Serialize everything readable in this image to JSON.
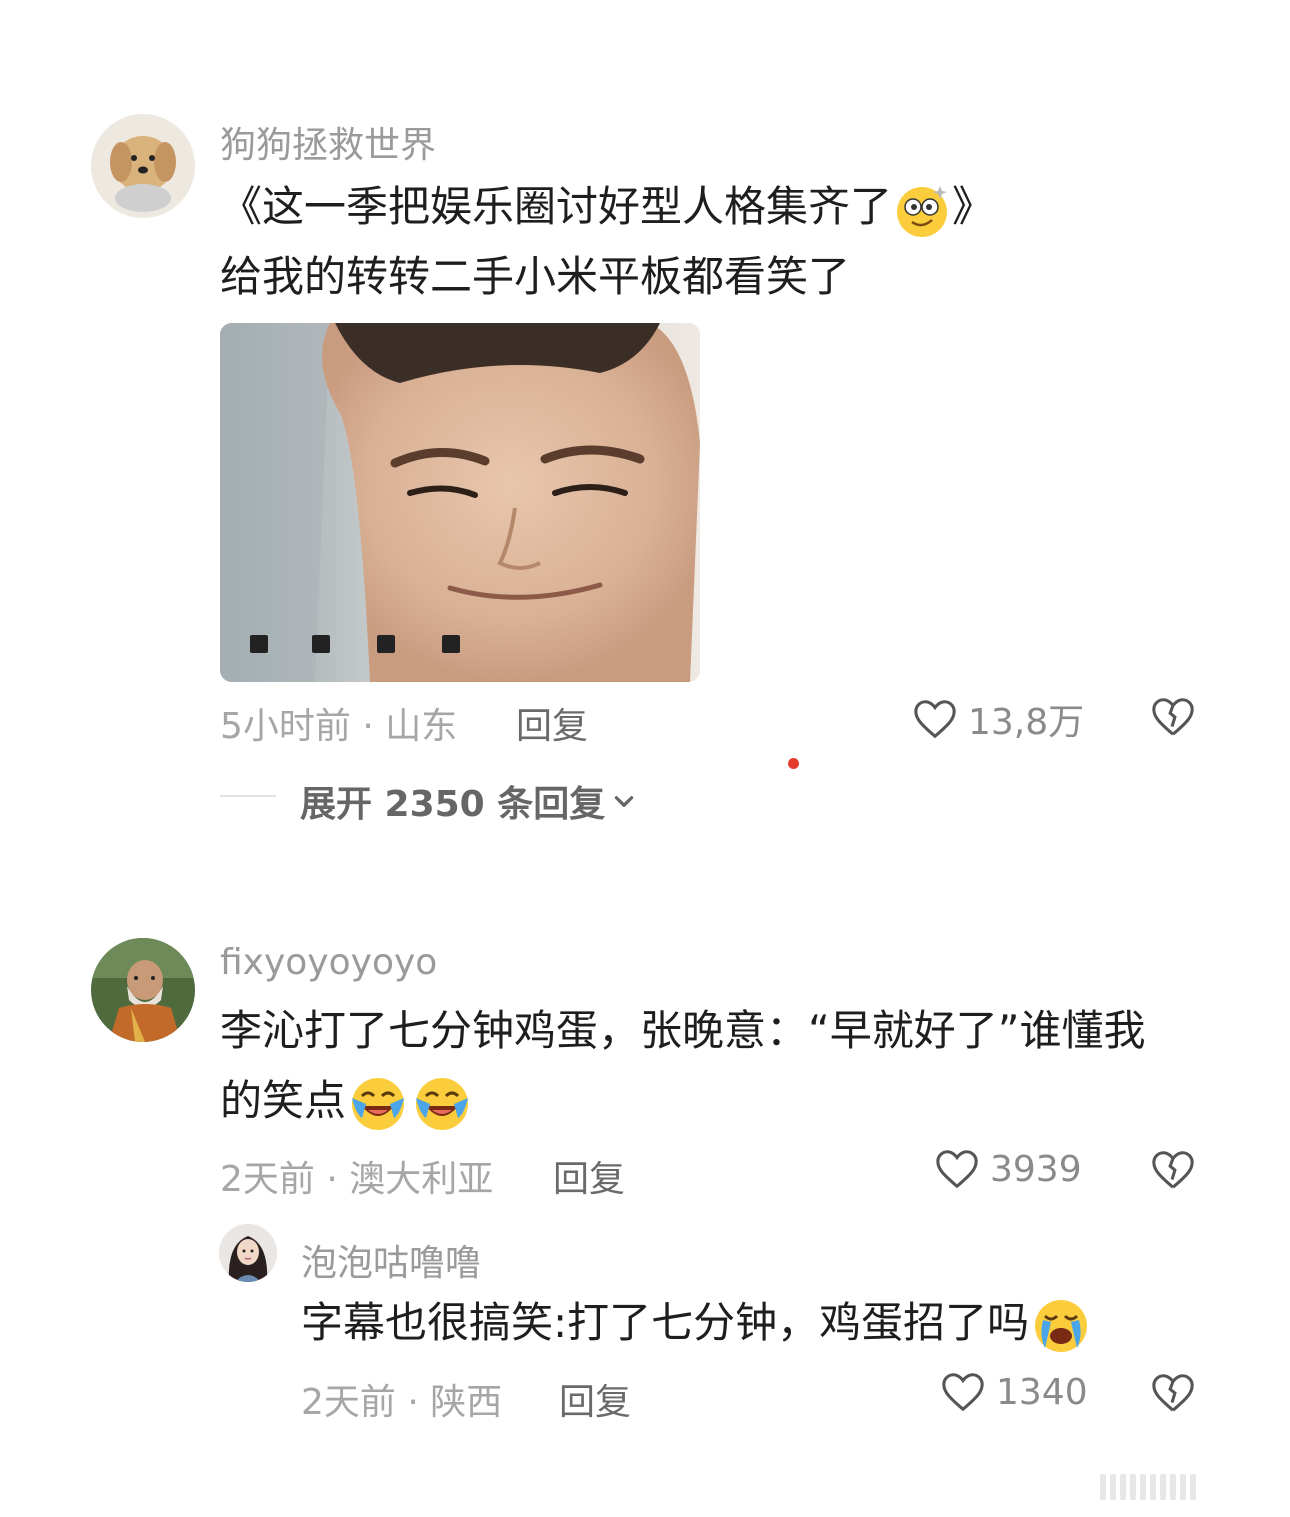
{
  "comments": [
    {
      "username": "狗狗拯救世界",
      "text_line1": "《这一季把娱乐圈讨好型人格集齐了",
      "text_line1_end": "》",
      "text_line2": "给我的转转二手小米平板都看笑了",
      "emoji": "dizzy-face-icon",
      "image_caption": "■ ■ ■ ■",
      "time_location": "5小时前 · 山东",
      "reply_label": "回复",
      "likes": "13,8万",
      "expand_label": "展开 2350 条回复",
      "avatar_icon": "golden-retriever-avatar"
    },
    {
      "username": "fixyoyoyoyo",
      "text_line1": "李沁打了七分钟鸡蛋，张晚意：“早就好了”谁懂我",
      "text_line2": "的笑点",
      "emoji": "laughing-crying-icon",
      "time_location": "2天前 · 澳大利亚",
      "reply_label": "回复",
      "likes": "3939",
      "avatar_icon": "monk-avatar"
    },
    {
      "username": "泡泡咕噜噜",
      "text_line1": "字幕也很搞笑:打了七分钟，鸡蛋招了吗",
      "emoji": "loudly-crying-icon",
      "time_location": "2天前 · 陕西",
      "reply_label": "回复",
      "likes": "1340",
      "avatar_icon": "girl-avatar"
    }
  ],
  "colors": {
    "accent_dot": "#e53b2f",
    "username": "#9a9a9a",
    "meta": "#a6a6a6"
  }
}
